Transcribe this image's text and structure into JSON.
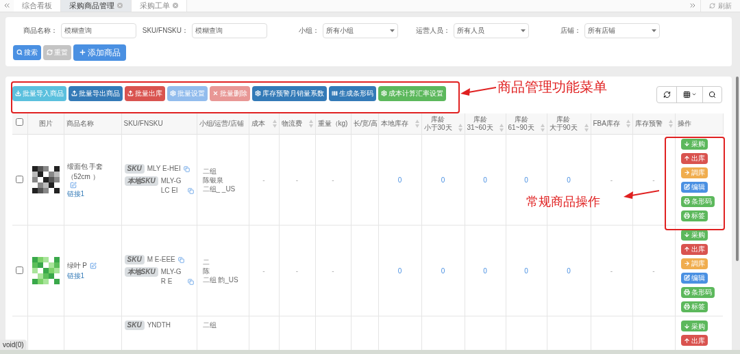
{
  "tabs": [
    {
      "label": "综合看板",
      "selected": false,
      "closable": false
    },
    {
      "label": "采购商品管理",
      "selected": true,
      "closable": true
    },
    {
      "label": "采购工单",
      "selected": false,
      "closable": true
    }
  ],
  "refresh": "刷新",
  "filters": [
    {
      "label": "商品名称：",
      "kind": "text",
      "placeholder": "模糊查询"
    },
    {
      "label": "SKU/FNSKU：",
      "kind": "text",
      "placeholder": "模糊查询"
    },
    {
      "label": "小组：",
      "kind": "select",
      "value": "所有小组"
    },
    {
      "label": "运营人员：",
      "kind": "select",
      "value": "所有人员"
    },
    {
      "label": "店铺：",
      "kind": "select",
      "value": "所有店铺"
    }
  ],
  "search_buttons": [
    {
      "label": "搜索",
      "kind": "search",
      "disabled": false
    },
    {
      "label": "重置",
      "kind": "reset",
      "disabled": true
    },
    {
      "label": "添加商品",
      "kind": "add",
      "disabled": false
    }
  ],
  "toolbar": [
    {
      "label": "批量导入商品",
      "kind": "import",
      "disabled": false
    },
    {
      "label": "批量导出商品",
      "kind": "export",
      "disabled": false
    },
    {
      "label": "批量出库",
      "kind": "outbound",
      "disabled": false
    },
    {
      "label": "批量设置",
      "kind": "settings",
      "disabled": true
    },
    {
      "label": "批量删除",
      "kind": "delete",
      "disabled": true
    },
    {
      "label": "库存预警月销量系数",
      "kind": "coefficient",
      "disabled": false
    },
    {
      "label": "生成条形码",
      "kind": "barcode",
      "disabled": false
    },
    {
      "label": "成本计算汇率设置",
      "kind": "rate",
      "disabled": false
    }
  ],
  "table": {
    "columns": [
      {
        "kind": "check",
        "checked": false
      },
      {
        "label": "图片",
        "sortable": false
      },
      {
        "label": "商品名称",
        "sortable": false
      },
      {
        "label": "SKU/FNSKU",
        "sortable": false
      },
      {
        "label": "小组/运营/店铺",
        "sortable": false
      },
      {
        "label": "成本",
        "sortable": true
      },
      {
        "label": "物流费",
        "sortable": true
      },
      {
        "label": "重量（kg)",
        "sortable": false
      },
      {
        "label": "长/宽/高",
        "sortable": false
      },
      {
        "label": "本地库存",
        "sortable": true
      },
      {
        "top": "库龄",
        "label": "小于30天",
        "sortable": true
      },
      {
        "top": "库龄",
        "label": "31~60天",
        "sortable": true
      },
      {
        "top": "库龄",
        "label": "61~90天",
        "sortable": true
      },
      {
        "top": "库龄",
        "label": "大于90天",
        "sortable": true
      },
      {
        "label": "FBA库存",
        "sortable": true
      },
      {
        "label": "库存预警",
        "sortable": true
      },
      {
        "label": "操作",
        "sortable": false
      }
    ],
    "rows": [
      {
        "checked": false,
        "name": "缎面包    手套（52cm    ）",
        "link": "链接1",
        "sku_tag": "SKU",
        "sku": "MLY       E-HEI",
        "local_tag": "本地SKU",
        "local_sku": "MLY-GLC     EI",
        "group": [
          "二组",
          "陈银泉",
          "二组_      _US"
        ],
        "values": [
          "-",
          "-",
          "-",
          "0",
          "0",
          "0",
          "0",
          "0",
          "-",
          "-"
        ],
        "actions": [
          {
            "label": "采购",
            "kind": "purchase"
          },
          {
            "label": "出库",
            "kind": "out"
          },
          {
            "label": "調库",
            "kind": "transfer"
          },
          {
            "label": "编辑",
            "kind": "edit"
          },
          {
            "label": "条形码",
            "kind": "print"
          },
          {
            "label": "标签",
            "kind": "print"
          }
        ]
      },
      {
        "checked": false,
        "name": "绿叶    P",
        "link": "链接1",
        "sku_tag": "SKU",
        "sku": "M       E-EEE",
        "local_tag": "本地SKU",
        "local_sku": "MLY-GR     E",
        "group": [
          "二",
          "陈",
          "二组       韵_US"
        ],
        "values": [
          "-",
          "-",
          "-",
          "0",
          "0",
          "0",
          "0",
          "0",
          "-",
          "-"
        ],
        "actions": [
          {
            "label": "采购",
            "kind": "purchase"
          },
          {
            "label": "出库",
            "kind": "out"
          },
          {
            "label": "調库",
            "kind": "transfer"
          },
          {
            "label": "编辑",
            "kind": "edit"
          },
          {
            "label": "条形码",
            "kind": "print"
          },
          {
            "label": "标签",
            "kind": "print"
          }
        ]
      },
      {
        "sku_tag": "SKU",
        "sku": "YNDTH",
        "group": [
          "二组"
        ],
        "actions": [
          {
            "label": "采购",
            "kind": "purchase"
          },
          {
            "label": "出库",
            "kind": "out"
          }
        ]
      }
    ]
  },
  "annotations": [
    {
      "text": "商品管理功能菜单"
    },
    {
      "text": "常规商品操作"
    }
  ],
  "status": "void(0)"
}
